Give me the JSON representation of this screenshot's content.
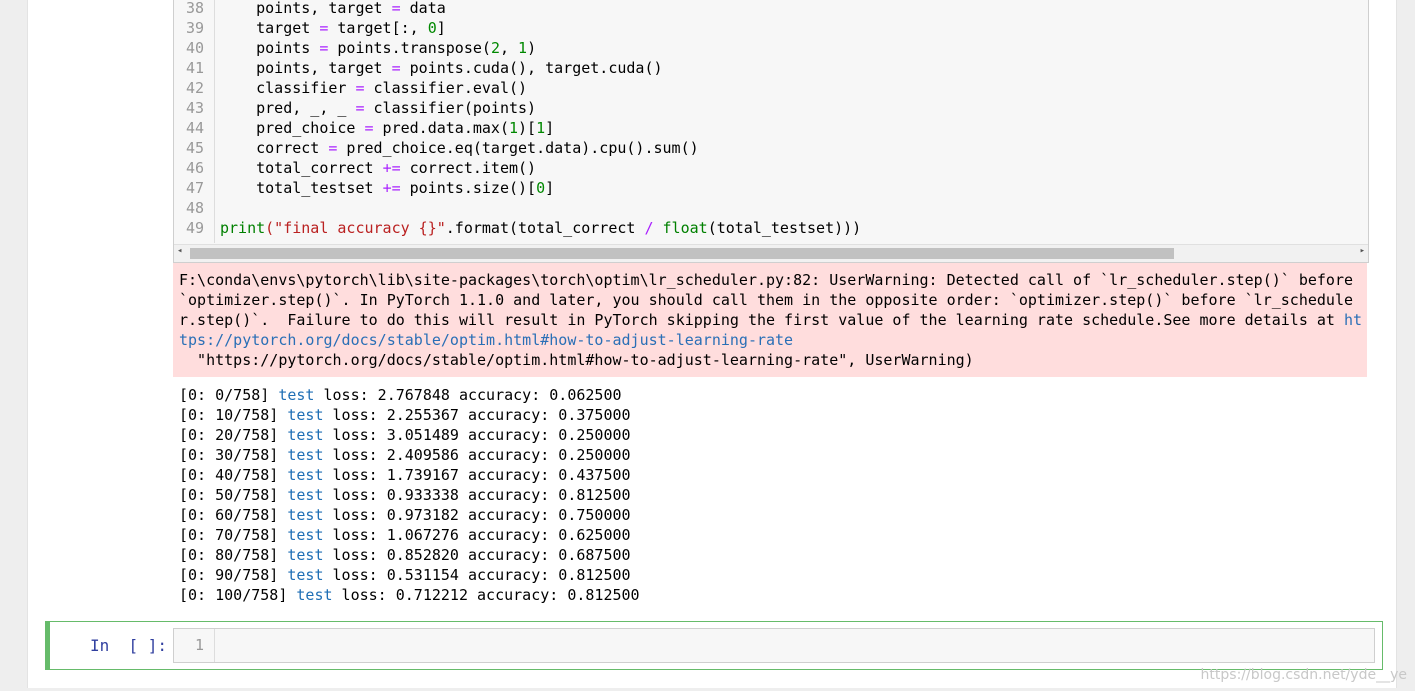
{
  "code_lines": [
    {
      "n": "38",
      "segs": [
        {
          "t": "    points, target "
        },
        {
          "t": "=",
          "c": "op"
        },
        {
          "t": " data"
        }
      ]
    },
    {
      "n": "39",
      "segs": [
        {
          "t": "    target "
        },
        {
          "t": "=",
          "c": "op"
        },
        {
          "t": " target[:, "
        },
        {
          "t": "0",
          "c": "num"
        },
        {
          "t": "]"
        }
      ]
    },
    {
      "n": "40",
      "segs": [
        {
          "t": "    points "
        },
        {
          "t": "=",
          "c": "op"
        },
        {
          "t": " points.transpose("
        },
        {
          "t": "2",
          "c": "num"
        },
        {
          "t": ", "
        },
        {
          "t": "1",
          "c": "num"
        },
        {
          "t": ")"
        }
      ]
    },
    {
      "n": "41",
      "segs": [
        {
          "t": "    points, target "
        },
        {
          "t": "=",
          "c": "op"
        },
        {
          "t": " points.cuda(), target.cuda()"
        }
      ]
    },
    {
      "n": "42",
      "segs": [
        {
          "t": "    classifier "
        },
        {
          "t": "=",
          "c": "op"
        },
        {
          "t": " classifier.eval()"
        }
      ]
    },
    {
      "n": "43",
      "segs": [
        {
          "t": "    pred, _, _ "
        },
        {
          "t": "=",
          "c": "op"
        },
        {
          "t": " classifier(points)"
        }
      ]
    },
    {
      "n": "44",
      "segs": [
        {
          "t": "    pred_choice "
        },
        {
          "t": "=",
          "c": "op"
        },
        {
          "t": " pred.data.max("
        },
        {
          "t": "1",
          "c": "num"
        },
        {
          "t": ")["
        },
        {
          "t": "1",
          "c": "num"
        },
        {
          "t": "]"
        }
      ]
    },
    {
      "n": "45",
      "segs": [
        {
          "t": "    correct "
        },
        {
          "t": "=",
          "c": "op"
        },
        {
          "t": " pred_choice.eq(target.data).cpu().sum()"
        }
      ]
    },
    {
      "n": "46",
      "segs": [
        {
          "t": "    total_correct "
        },
        {
          "t": "+=",
          "c": "op"
        },
        {
          "t": " correct.item()"
        }
      ]
    },
    {
      "n": "47",
      "segs": [
        {
          "t": "    total_testset "
        },
        {
          "t": "+=",
          "c": "op"
        },
        {
          "t": " points.size()["
        },
        {
          "t": "0",
          "c": "num"
        },
        {
          "t": "]"
        }
      ]
    },
    {
      "n": "48",
      "segs": [
        {
          "t": ""
        }
      ]
    },
    {
      "n": "49",
      "segs": [
        {
          "t": "print",
          "c": "bi"
        },
        {
          "t": "(\"final accuracy {}\"",
          "c": "str"
        },
        {
          "t": ".format(total_correct "
        },
        {
          "t": "/",
          "c": "op"
        },
        {
          "t": " "
        },
        {
          "t": "float",
          "c": "bi"
        },
        {
          "t": "(total_testset)))"
        }
      ]
    }
  ],
  "stderr_lines": [
    {
      "segs": [
        {
          "t": "F:\\conda\\envs\\pytorch\\lib\\site-packages\\torch\\optim\\lr_scheduler.py:82: UserWarning: Detected call of `lr_scheduler.step()` before"
        }
      ]
    },
    {
      "segs": [
        {
          "t": "`optimizer.step()`. In PyTorch 1.1.0 and later, you should call them in the opposite order: `optimizer.step()` before `lr_schedule"
        }
      ]
    },
    {
      "segs": [
        {
          "t": "r.step()`.  Failure to do this will result in PyTorch skipping the first value of the learning rate schedule.See more details at "
        },
        {
          "t": "ht",
          "c": "link"
        }
      ]
    },
    {
      "segs": [
        {
          "t": "tps://pytorch.org/docs/stable/optim.html#how-to-adjust-learning-rate",
          "c": "link"
        }
      ]
    },
    {
      "segs": [
        {
          "t": "  \"https://pytorch.org/docs/stable/optim.html#how-to-adjust-learning-rate\", UserWarning)"
        }
      ]
    }
  ],
  "stdout_lines": [
    {
      "pre": "[0: 0/758] ",
      "kw": "test",
      "post": " loss: 2.767848 accuracy: 0.062500"
    },
    {
      "pre": "[0: 10/758] ",
      "kw": "test",
      "post": " loss: 2.255367 accuracy: 0.375000"
    },
    {
      "pre": "[0: 20/758] ",
      "kw": "test",
      "post": " loss: 3.051489 accuracy: 0.250000"
    },
    {
      "pre": "[0: 30/758] ",
      "kw": "test",
      "post": " loss: 2.409586 accuracy: 0.250000"
    },
    {
      "pre": "[0: 40/758] ",
      "kw": "test",
      "post": " loss: 1.739167 accuracy: 0.437500"
    },
    {
      "pre": "[0: 50/758] ",
      "kw": "test",
      "post": " loss: 0.933338 accuracy: 0.812500"
    },
    {
      "pre": "[0: 60/758] ",
      "kw": "test",
      "post": " loss: 0.973182 accuracy: 0.750000"
    },
    {
      "pre": "[0: 70/758] ",
      "kw": "test",
      "post": " loss: 1.067276 accuracy: 0.625000"
    },
    {
      "pre": "[0: 80/758] ",
      "kw": "test",
      "post": " loss: 0.852820 accuracy: 0.687500"
    },
    {
      "pre": "[0: 90/758] ",
      "kw": "test",
      "post": " loss: 0.531154 accuracy: 0.812500"
    },
    {
      "pre": "[0: 100/758] ",
      "kw": "test",
      "post": " loss: 0.712212 accuracy: 0.812500"
    }
  ],
  "new_cell": {
    "prompt": "In  [ ]:",
    "line_number": "1"
  },
  "scroll_arrows": {
    "left": "◂",
    "right": "▸"
  },
  "watermark": "https://blog.csdn.net/yde__ye"
}
